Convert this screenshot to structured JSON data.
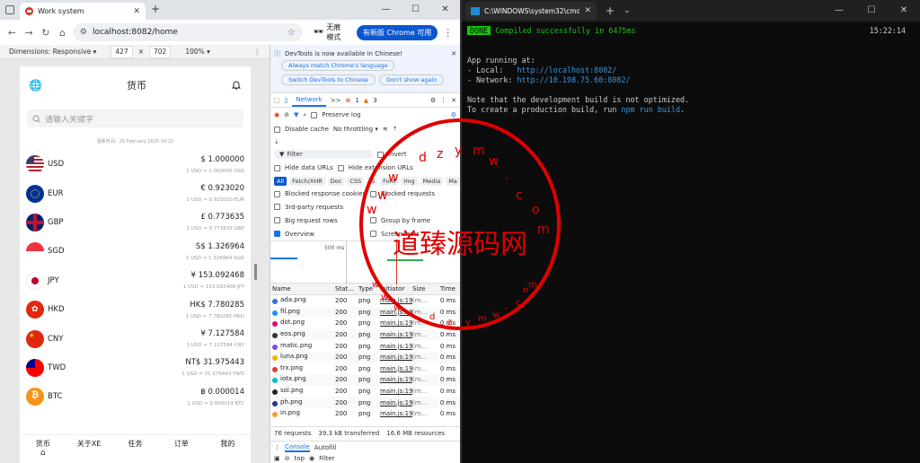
{
  "browser": {
    "tab_title": "Work system",
    "url": "localhost:8082/home",
    "incognito_label": "无痕模式",
    "new_chrome_label": "有新版 Chrome 可用"
  },
  "device_toolbar": {
    "dimensions_label": "Dimensions: Responsive",
    "width": "427",
    "times": "×",
    "height": "702",
    "zoom": "100%"
  },
  "app": {
    "title": "货币",
    "search_placeholder": "请输入关键字",
    "updated": "更新时间：26 February 2025 14:22",
    "currencies": [
      {
        "code": "USD",
        "value": "$ 1.000000",
        "rate": "1 USD ≈ 1.000000 USD",
        "flag": "us"
      },
      {
        "code": "EUR",
        "value": "€ 0.923020",
        "rate": "1 USD ≈ 0.923020 EUR",
        "flag": "eu"
      },
      {
        "code": "GBP",
        "value": "£ 0.773635",
        "rate": "1 USD ≈ 0.773635 GBP",
        "flag": "gb"
      },
      {
        "code": "SGD",
        "value": "S$ 1.326964",
        "rate": "1 USD ≈ 1.326964 SGD",
        "flag": "sg"
      },
      {
        "code": "JPY",
        "value": "¥ 153.092468",
        "rate": "1 USD ≈ 153.092468 JPY",
        "flag": "jp"
      },
      {
        "code": "HKD",
        "value": "HK$ 7.780285",
        "rate": "1 USD ≈ 7.780285 HKD",
        "flag": "hk"
      },
      {
        "code": "CNY",
        "value": "¥ 7.127584",
        "rate": "1 USD ≈ 7.127584 CNY",
        "flag": "cn"
      },
      {
        "code": "TWD",
        "value": "NT$ 31.975443",
        "rate": "1 USD ≈ 31.975443 TWD",
        "flag": "tw"
      },
      {
        "code": "BTC",
        "value": "฿ 0.000014",
        "rate": "1 USD ≈ 0.000014 BTC",
        "flag": "btc"
      }
    ],
    "nav": [
      "货币",
      "关于XE",
      "任务",
      "订单",
      "我的"
    ]
  },
  "devtools": {
    "banner": "DevTools is now available in Chinese!",
    "btn_match": "Always match Chrome's language",
    "btn_switch": "Switch DevTools to Chinese",
    "btn_dont": "Don't show again",
    "tab_network": "Network",
    "more_tabs": ">>",
    "errors": "1",
    "warnings": "3",
    "preserve_log": "Preserve log",
    "disable_cache": "Disable cache",
    "throttling": "No throttling",
    "filter": "Filter",
    "invert": "Invert",
    "hide_data": "Hide data URLs",
    "hide_ext": "Hide extension URLs",
    "types": [
      "All",
      "Fetch/XHR",
      "Doc",
      "CSS",
      "JS",
      "Font",
      "Img",
      "Media",
      "Ma"
    ],
    "blocked_cookies": "Blocked response cookies",
    "blocked_requests": "Blocked requests",
    "third_party": "3rd-party requests",
    "big_rows": "Big request rows",
    "group_frame": "Group by frame",
    "overview": "Overview",
    "screenshots": "Screenshots",
    "timeline_label": "500 ms",
    "headers": [
      "Name",
      "Stat...",
      "Type",
      "Initiator",
      "Size",
      "Time"
    ],
    "requests": [
      {
        "name": "ada.png",
        "status": "200",
        "type": "png",
        "init": "main.js:19",
        "size": "(m...",
        "time": "0 ms",
        "color": "#2a6fdb"
      },
      {
        "name": "fil.png",
        "status": "200",
        "type": "png",
        "init": "main.js:19",
        "size": "(m...",
        "time": "0 ms",
        "color": "#1e90ff"
      },
      {
        "name": "dot.png",
        "status": "200",
        "type": "png",
        "init": "main.js:19",
        "size": "(m...",
        "time": "0 ms",
        "color": "#e6007a"
      },
      {
        "name": "eos.png",
        "status": "200",
        "type": "png",
        "init": "main.js:19",
        "size": "(m...",
        "time": "0 ms",
        "color": "#333333"
      },
      {
        "name": "matic.png",
        "status": "200",
        "type": "png",
        "init": "main.js:19",
        "size": "(m...",
        "time": "0 ms",
        "color": "#8247e5"
      },
      {
        "name": "luna.png",
        "status": "200",
        "type": "png",
        "init": "main.js:19",
        "size": "(m...",
        "time": "0 ms",
        "color": "#f4b400"
      },
      {
        "name": "trx.png",
        "status": "200",
        "type": "png",
        "init": "main.js:19",
        "size": "(m...",
        "time": "0 ms",
        "color": "#e53935"
      },
      {
        "name": "iotx.png",
        "status": "200",
        "type": "png",
        "init": "main.js:19",
        "size": "(m...",
        "time": "0 ms",
        "color": "#00bcd4"
      },
      {
        "name": "sol.png",
        "status": "200",
        "type": "png",
        "init": "main.js:19",
        "size": "(m...",
        "time": "0 ms",
        "color": "#222222"
      },
      {
        "name": "ph.png",
        "status": "200",
        "type": "png",
        "init": "main.js:19",
        "size": "(m...",
        "time": "0 ms",
        "color": "#1e3a8a"
      },
      {
        "name": "in.png",
        "status": "200",
        "type": "png",
        "init": "main.js:19",
        "size": "(m...",
        "time": "0 ms",
        "color": "#ff9933"
      }
    ],
    "summary_requests": "76 requests",
    "summary_transferred": "39.3 kB transferred",
    "summary_resources": "16.6 MB resources",
    "drawer_console": "Console",
    "drawer_autofill": "Autofill",
    "drawer_top": "top",
    "drawer_filter": "Filter"
  },
  "cmd": {
    "title": "C:\\WINDOWS\\system32\\cmd.",
    "done": "DONE",
    "compiled": "Compiled successfully in 6475ms",
    "time": "15:22:14",
    "running": "App running at:",
    "local_label": "- Local:   ",
    "local_url": "http://localhost:8082/",
    "network_label": "- Network: ",
    "network_url": "http://10.198.75.60:8082/",
    "note1": "Note that the development build is not optimized.",
    "note2a": "To create a production build, run ",
    "note2b": "npm run build",
    "note2c": "."
  },
  "stamp": {
    "center_text": "道臻源码网",
    "ring_text": "wwwdzymw.com"
  }
}
